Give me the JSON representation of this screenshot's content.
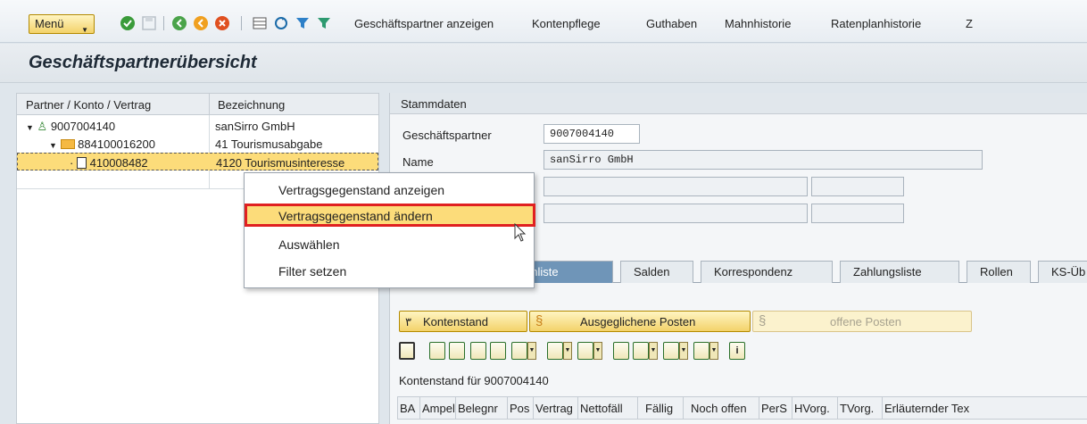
{
  "toolbar": {
    "menu_label": "Menü",
    "links": [
      "Geschäftspartner anzeigen",
      "Kontenpflege",
      "Guthaben",
      "Mahnhistorie",
      "Ratenplanhistorie",
      "Z"
    ]
  },
  "title": "Geschäftspartnerübersicht",
  "tree": {
    "col1": "Partner / Konto / Vertrag",
    "col2": "Bezeichnung",
    "rows": [
      {
        "id": "9007004140",
        "desc": "sanSirro GmbH"
      },
      {
        "id": "884100016200",
        "desc": "41     Tourismusabgabe"
      },
      {
        "id": "410008482",
        "desc": "4120 Tourismusinteresse"
      }
    ]
  },
  "stammdaten": {
    "header": "Stammdaten",
    "gp_label": "Geschäftspartner",
    "gp_value": "9007004140",
    "name_label": "Name",
    "name_value": "sanSirro GmbH"
  },
  "tabs": [
    "Postenliste",
    "Salden",
    "Korrespondenz",
    "Zahlungsliste",
    "Rollen",
    "KS-Üb"
  ],
  "buttons": {
    "kontenstand": "Kontenstand",
    "ausgeglichen": "Ausgeglichene Posten",
    "offen": "offene Posten"
  },
  "info_line": "Kontenstand für 9007004140",
  "grid_cols": [
    "BA",
    "Ampel",
    "Belegnr",
    "Pos",
    "Vertrag",
    "Nettofäll",
    "Fällig",
    "Noch offen",
    "PerS",
    "HVorg.",
    "TVorg.",
    "Erläuternder Tex"
  ],
  "context_menu": {
    "items": [
      "Vertragsgegenstand anzeigen",
      "Vertragsgegenstand ändern",
      "Auswählen",
      "Filter setzen"
    ],
    "highlight_index": 1
  },
  "colors": {
    "accent_yellow": "#fcdc7a",
    "highlight_border": "#e02020",
    "active_tab": "#6f95b8"
  }
}
